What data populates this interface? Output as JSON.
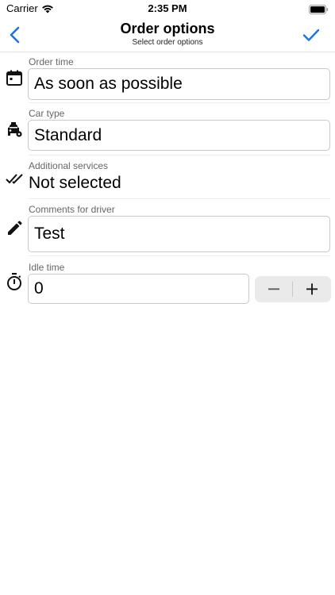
{
  "status_bar": {
    "carrier": "Carrier",
    "time": "2:35 PM"
  },
  "nav": {
    "title": "Order options",
    "subtitle": "Select order options"
  },
  "colors": {
    "accent": "#1a73e8",
    "icon": "#111111",
    "label": "#666666"
  },
  "icons": {
    "back": "chevron-left-icon",
    "done": "checkmark-icon",
    "order_time": "calendar-icon",
    "car_type": "car-settings-icon",
    "services": "double-check-icon",
    "comments": "pencil-icon",
    "idle": "timer-icon"
  },
  "fields": {
    "order_time": {
      "label": "Order time",
      "value": "As soon as possible"
    },
    "car_type": {
      "label": "Car type",
      "value": "Standard"
    },
    "additional_services": {
      "label": "Additional services",
      "value": "Not selected"
    },
    "comments": {
      "label": "Comments for driver",
      "value": "Test"
    },
    "idle_time": {
      "label": "Idle time",
      "value": "0"
    }
  }
}
